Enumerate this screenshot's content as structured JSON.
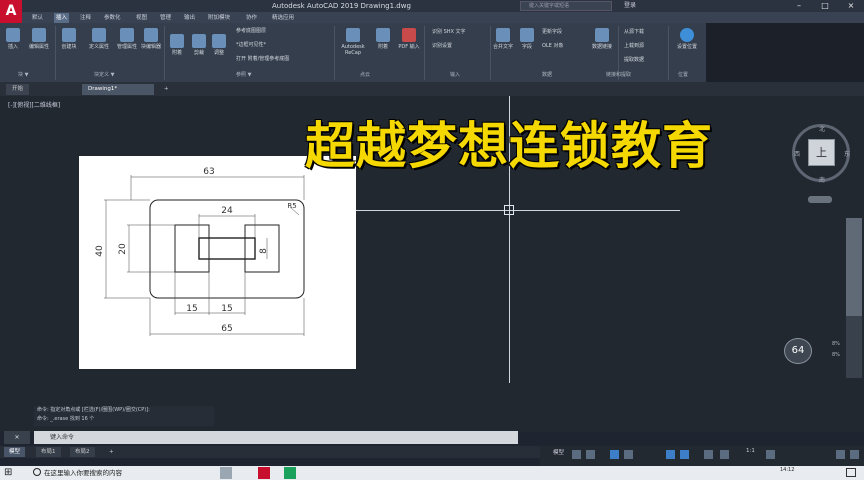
{
  "window": {
    "app_logo": "A",
    "title": "Autodesk AutoCAD 2019    Drawing1.dwg",
    "search_placeholder": "键入关键字或短语",
    "user": "登录",
    "controls": {
      "minimize": "–",
      "maximize": "□",
      "close": "×"
    }
  },
  "ribbon_tabs": [
    "默认",
    "插入",
    "注释",
    "参数化",
    "视图",
    "管理",
    "输出",
    "附加模块",
    "协作",
    "精选应用"
  ],
  "ribbon_active_tab": "插入",
  "ribbon": {
    "block_buttons": [
      "插入",
      "编辑属性",
      "创建块",
      "定义属性",
      "管理属性",
      "块编辑器"
    ],
    "reference_buttons": [
      "附着",
      "剪裁",
      "调整"
    ],
    "reference_small": [
      "参考底图图层",
      "*边框可见性*",
      "打开 附着/管理参考底图"
    ],
    "pointcloud_buttons": [
      "Autodesk ReCap",
      "附着",
      "PDF 输入"
    ],
    "import_small": [
      "识别 SHX 文字",
      "识别设置"
    ],
    "data_buttons": [
      "合并文字",
      "字段",
      "更新字段",
      "OLE 对象",
      "数据链接"
    ],
    "linking_small": [
      "从源下载",
      "上载到源",
      "提取数据"
    ],
    "location_button": "设置位置",
    "panels": [
      "块 ▼",
      "块定义 ▼",
      "参照 ▼",
      "点云",
      "输入",
      "数据",
      "链接和提取",
      "位置"
    ]
  },
  "doc_tabs": [
    "开始",
    "Drawing1*",
    "+"
  ],
  "viewport_label": "[-][俯视][二维线框]",
  "drawing_dims": {
    "top": "63",
    "inner": "24",
    "left": "40",
    "left_inner": "20",
    "small": "8",
    "b1": "15",
    "b2": "15",
    "bottom": "65",
    "radius": "R5"
  },
  "watermark": "超越梦想连锁教育",
  "viewcube": {
    "face": "上",
    "north": "北",
    "south": "南",
    "west": "西",
    "east": "东",
    "wcs": "WCS"
  },
  "zoom_badge": "64",
  "zoom_labels": [
    "8%",
    "8%"
  ],
  "command": {
    "history": [
      "命令: 指定对角点或 [栏选(F)/圈围(WP)/圈交(CP)]:",
      "命令: _.erase 找到 16 个"
    ],
    "prompt": "键入命令"
  },
  "layout_tabs": [
    "模型",
    "布局1",
    "布局2",
    "+"
  ],
  "status": {
    "model": "模型",
    "scale": "1:1"
  },
  "taskbar": {
    "search_placeholder": "在这里输入你要搜索的内容",
    "time": "14:12"
  }
}
